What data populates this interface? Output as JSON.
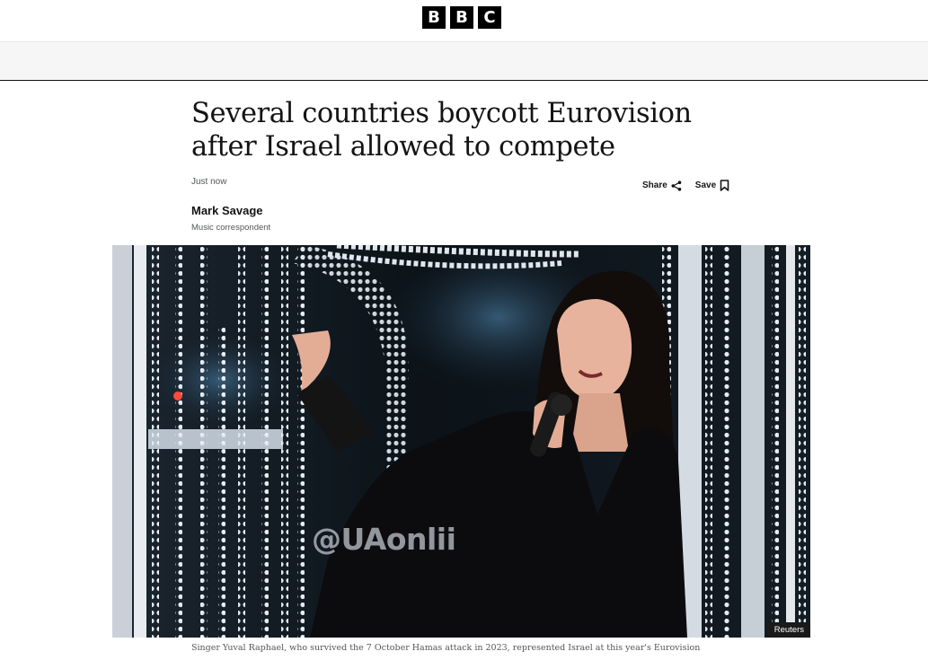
{
  "header": {
    "logo_letters": [
      "B",
      "B",
      "C"
    ]
  },
  "article": {
    "headline": "Several countries boycott Eurovision after Israel allowed to compete",
    "timestamp": "Just now",
    "share_label": "Share",
    "save_label": "Save",
    "author_name": "Mark Savage",
    "author_role": "Music correspondent",
    "image": {
      "credit": "Reuters",
      "watermark": "@UAonlii",
      "caption": "Singer Yuval Raphael, who survived the 7 October Hamas attack in 2023, represented Israel at this year's Eurovision"
    }
  },
  "icons": {
    "share": "share-icon",
    "save": "bookmark-icon"
  },
  "colors": {
    "logo_bg": "#000000",
    "text_primary": "#141414",
    "text_secondary": "#545658",
    "nav_band": "#f6f6f6"
  }
}
